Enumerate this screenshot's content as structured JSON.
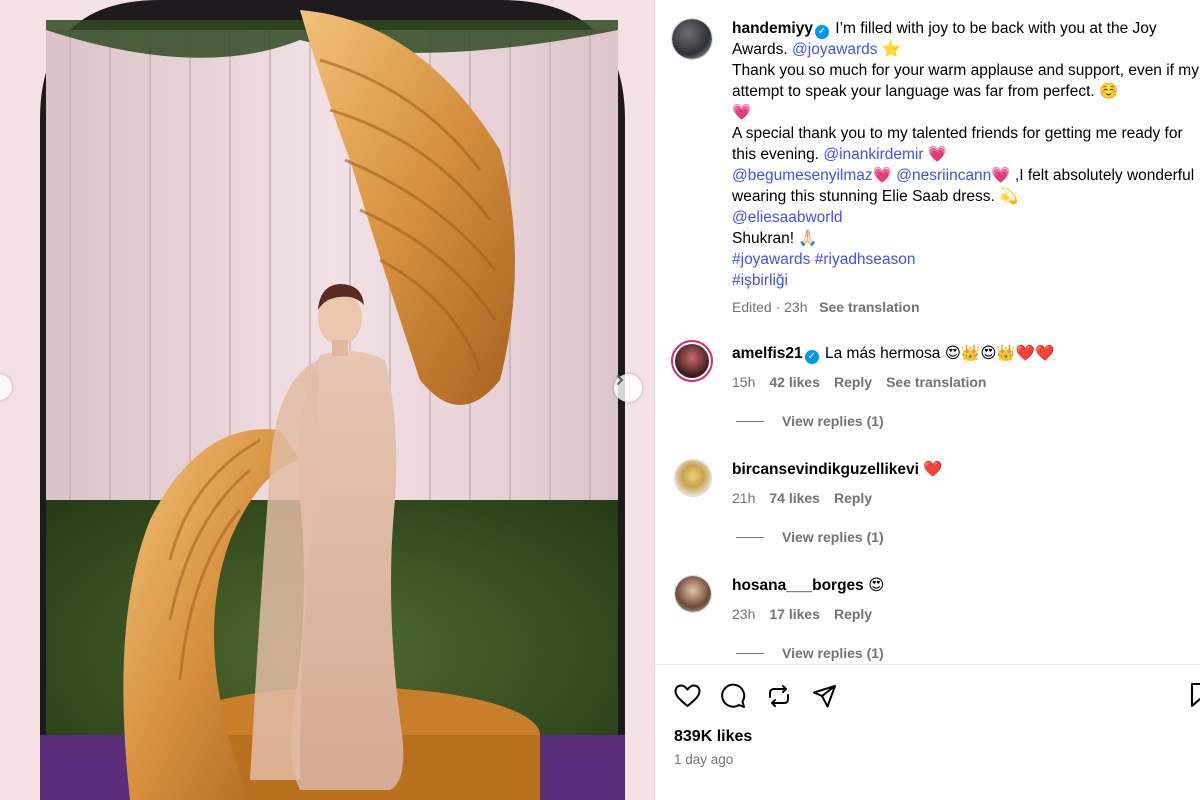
{
  "post": {
    "username": "handemiyy",
    "caption_line1": "I’m filled with joy to be back with you at the Joy Awards.",
    "mention_joyawards": "@joyawards",
    "star_emoji": "⭐",
    "caption_line2": "Thank you so much for your warm applause and support, even if my attempt to speak your language was far from perfect. ☺️",
    "heart_emoji": "💗",
    "caption_line3": "A special thank you to my talented friends for getting me ready for this evening.",
    "mention_inankirdemir": "@inankirdemir",
    "mention_begum": "@begumesenyilmaz",
    "mention_nesrin": "@nesriincann",
    "caption_line4": ",I felt absolutely wonderful wearing this stunning Elie Saab dress. 💫",
    "mention_eliesaab": "@eliesaabworld",
    "caption_line5": "Shukran! 🙏🏻",
    "hashtag_joyawards": "#joyawards",
    "hashtag_riyadh": "#riyadhseason",
    "hashtag_isbirligi": "#işbirliği",
    "edited": "Edited · 23h",
    "see_translation": "See translation"
  },
  "comments": [
    {
      "username": "amelfis21",
      "verified": true,
      "text": "La más hermosa 😍👑😍👑❤️❤️",
      "time": "15h",
      "likes": "42 likes",
      "reply": "Reply",
      "translation": "See translation",
      "view_replies": "View replies (1)"
    },
    {
      "username": "bircansevindikguzellikevi",
      "verified": false,
      "text": "❤️",
      "time": "21h",
      "likes": "74 likes",
      "reply": "Reply",
      "view_replies": "View replies (1)"
    },
    {
      "username": "hosana___borges",
      "verified": false,
      "text": "😍",
      "time": "23h",
      "likes": "17 likes",
      "reply": "Reply",
      "view_replies": "View replies (1)"
    }
  ],
  "footer": {
    "likes": "839K likes",
    "date": "1 day ago"
  },
  "icons": {
    "like": "heart-icon",
    "comment": "comment-icon",
    "share": "repost-icon",
    "send": "send-icon",
    "save": "bookmark-icon"
  },
  "colors": {
    "link": "#4150f7",
    "muted": "#737373",
    "verified": "#0095f6"
  }
}
